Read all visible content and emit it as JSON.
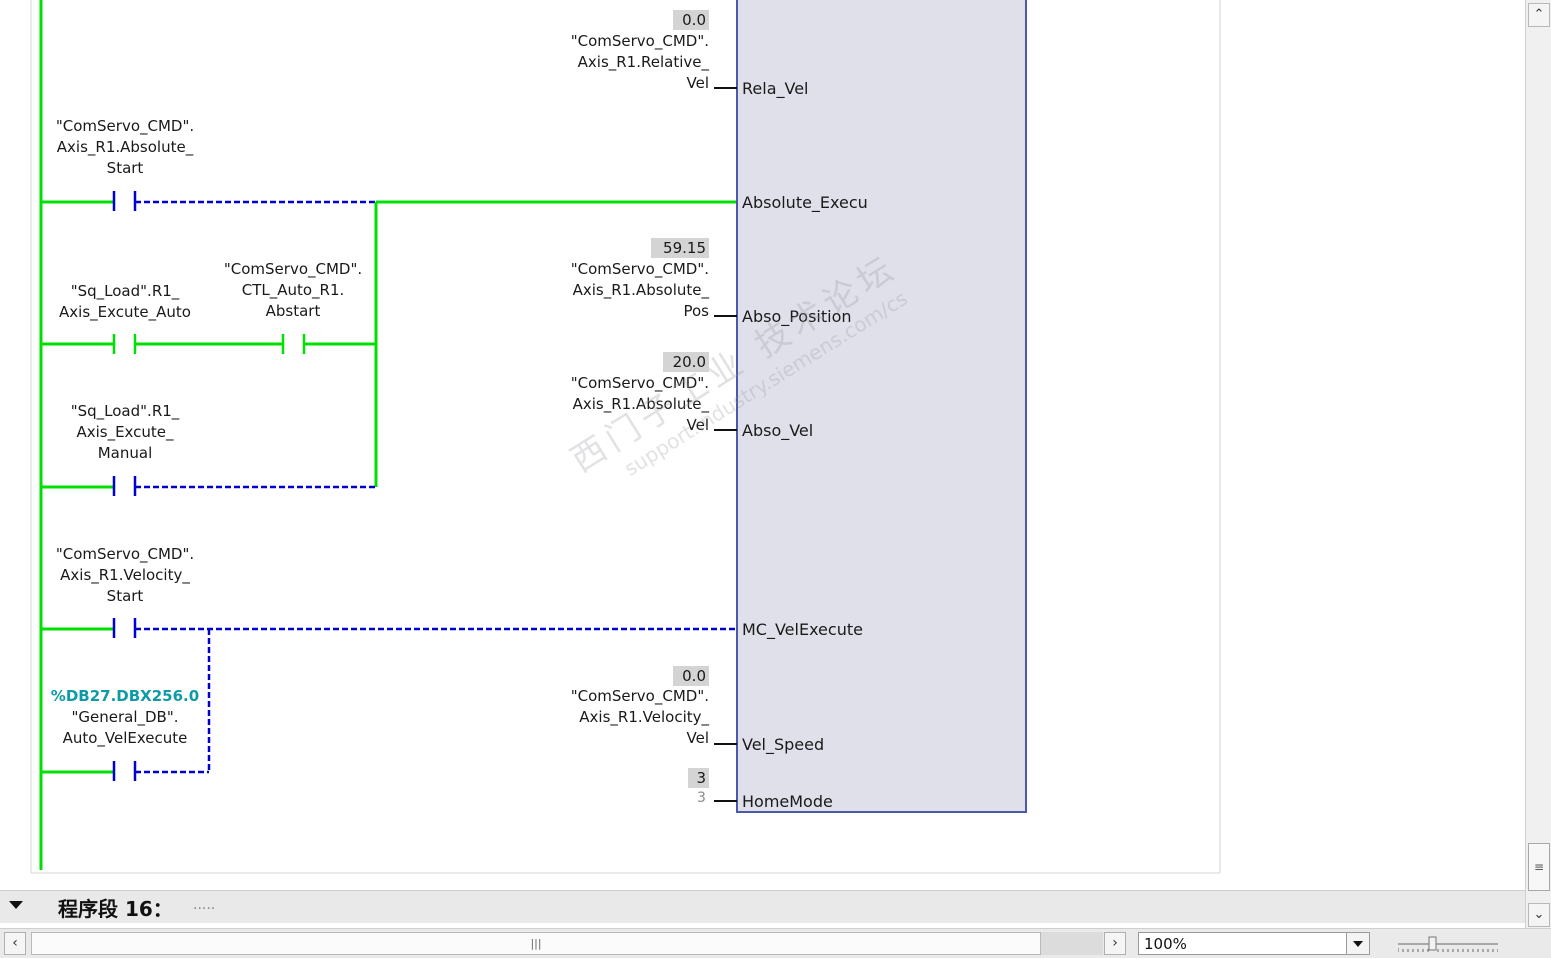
{
  "operands": {
    "axis_start": [
      "\"ComServo_CMD\".",
      "Axis_R1.Absolute_",
      "Start"
    ],
    "auto_excute": [
      "\"Sq_Load\".R1_",
      "Axis_Excute_Auto"
    ],
    "auto_abstart": [
      "\"ComServo_CMD\".",
      "CTL_Auto_R1.",
      "Abstart"
    ],
    "manual_excute": [
      "\"Sq_Load\".R1_",
      "Axis_Excute_",
      "Manual"
    ],
    "velocity_start": [
      "\"ComServo_CMD\".",
      "Axis_R1.Velocity_",
      "Start"
    ],
    "auto_velexecute_addr": "%DB27.DBX256.0",
    "auto_velexecute": [
      "\"General_DB\".",
      "Auto_VelExecute"
    ]
  },
  "params": {
    "rela_vel": {
      "value": "0.0",
      "operand": [
        "\"ComServo_CMD\".",
        "Axis_R1.Relative_",
        "Vel"
      ],
      "pin": "Rela_Vel"
    },
    "absolute_execu": {
      "pin": "Absolute_Execu"
    },
    "abso_position": {
      "value": "59.15",
      "operand": [
        "\"ComServo_CMD\".",
        "Axis_R1.Absolute_",
        "Pos"
      ],
      "pin": "Abso_Position"
    },
    "abso_vel": {
      "value": "20.0",
      "operand": [
        "\"ComServo_CMD\".",
        "Axis_R1.Absolute_",
        "Vel"
      ],
      "pin": "Abso_Vel"
    },
    "mc_velexecute": {
      "pin": "MC_VelExecute"
    },
    "vel_speed": {
      "value": "0.0",
      "operand": [
        "\"ComServo_CMD\".",
        "Axis_R1.Velocity_",
        "Vel"
      ],
      "pin": "Vel_Speed"
    },
    "homemode": {
      "value": "3",
      "default": "3",
      "pin": "HomeMode"
    }
  },
  "watermark": {
    "line1": "西门子工业 技术论坛",
    "line2": "support.industry.siemens.com/cs"
  },
  "network": {
    "title": "程序段 16：",
    "comment": "....."
  },
  "bottom": {
    "zoom": "100%"
  },
  "icons": {
    "collapse": "triangle-down-icon",
    "scroll_up": "chevron-up-icon",
    "scroll_down": "chevron-down-icon",
    "scroll_left": "chevron-left-icon",
    "scroll_right": "chevron-right-icon",
    "dropdown": "triangle-down-icon",
    "grip": "grip-icon"
  },
  "colors": {
    "power_flow": "#00e000",
    "no_flow": "#0000d0",
    "block_fill": "#dfe0ea",
    "block_border": "#4a5aa8",
    "address": "#0f9aa8"
  }
}
